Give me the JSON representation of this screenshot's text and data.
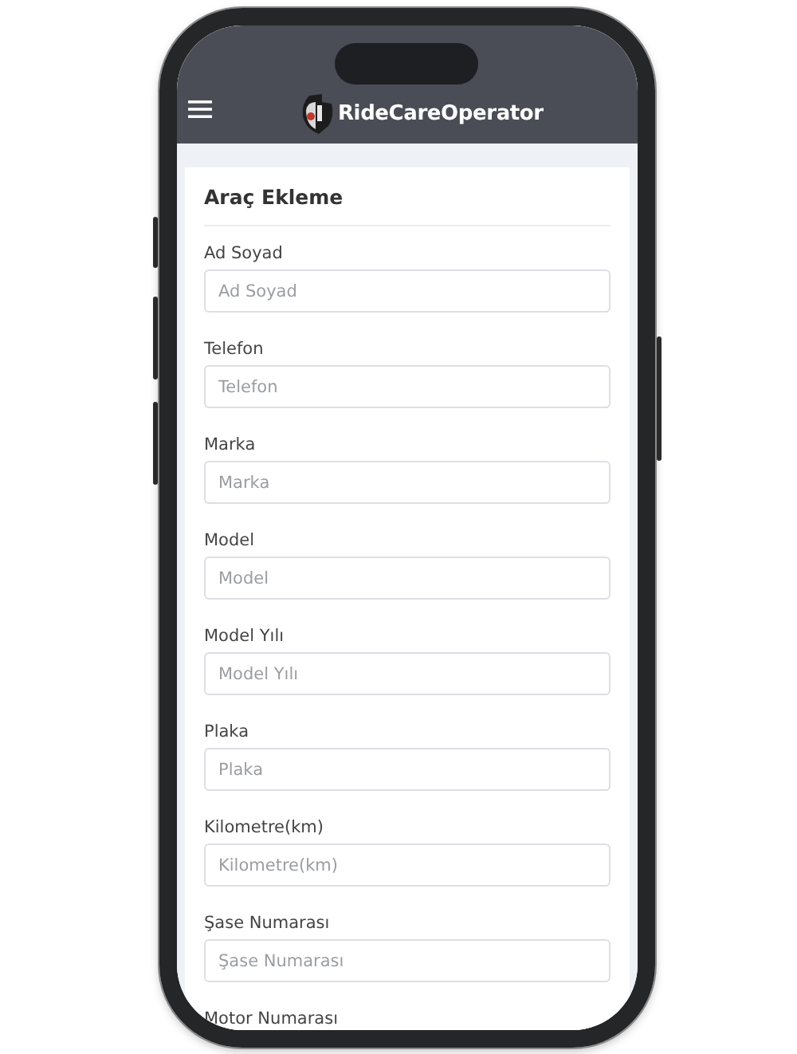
{
  "header": {
    "title": "RideCareOperator"
  },
  "form": {
    "title": "Araç Ekleme",
    "fields": [
      {
        "label": "Ad Soyad",
        "placeholder": "Ad Soyad"
      },
      {
        "label": "Telefon",
        "placeholder": "Telefon"
      },
      {
        "label": "Marka",
        "placeholder": "Marka"
      },
      {
        "label": "Model",
        "placeholder": "Model"
      },
      {
        "label": "Model Yılı",
        "placeholder": "Model Yılı"
      },
      {
        "label": "Plaka",
        "placeholder": "Plaka"
      },
      {
        "label": "Kilometre(km)",
        "placeholder": "Kilometre(km)"
      },
      {
        "label": "Şase Numarası",
        "placeholder": "Şase Numarası"
      },
      {
        "label": "Motor Numarası"
      }
    ]
  }
}
